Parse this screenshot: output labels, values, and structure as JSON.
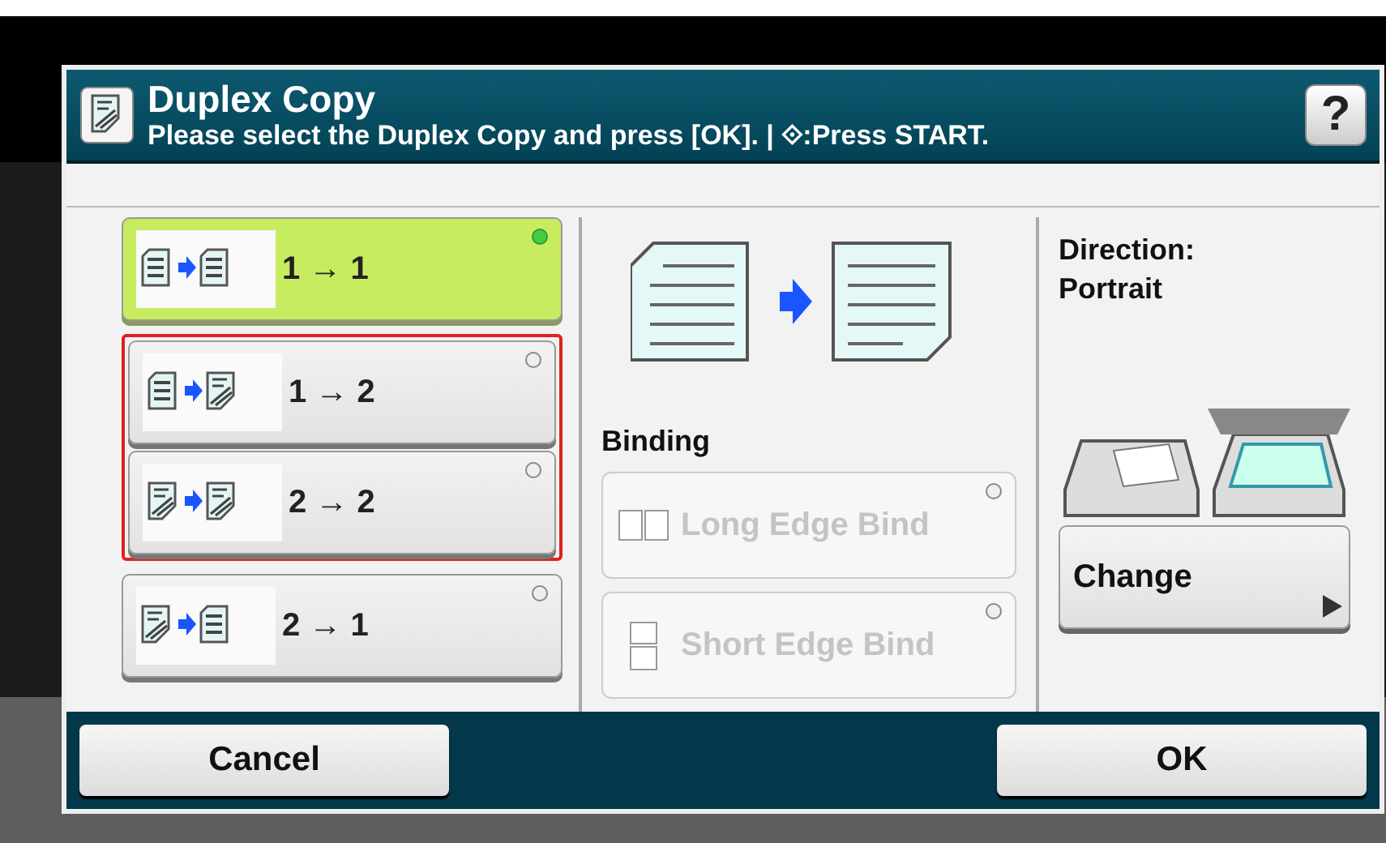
{
  "header": {
    "title": "Duplex Copy",
    "instruction": "Please select the Duplex Copy and press [OK]. | ⟐:Press START.",
    "help": "?"
  },
  "modes": [
    {
      "label": "1 → 1",
      "kind": "simplex_simplex",
      "selected": true,
      "framed": false
    },
    {
      "label": "1 → 2",
      "kind": "simplex_duplex",
      "selected": false,
      "framed": true
    },
    {
      "label": "2 → 2",
      "kind": "duplex_duplex",
      "selected": false,
      "framed": true
    },
    {
      "label": "2 → 1",
      "kind": "duplex_simplex",
      "selected": false,
      "framed": false
    }
  ],
  "binding": {
    "title": "Binding",
    "options": [
      {
        "label": "Long Edge Bind",
        "kind": "long",
        "selected": false,
        "disabled": true
      },
      {
        "label": "Short Edge Bind",
        "kind": "short",
        "selected": false,
        "disabled": true
      }
    ]
  },
  "direction": {
    "label": "Direction:",
    "value": "Portrait",
    "button": "Change"
  },
  "buttons": [
    {
      "label": "Cancel"
    },
    {
      "label": "OK"
    }
  ]
}
